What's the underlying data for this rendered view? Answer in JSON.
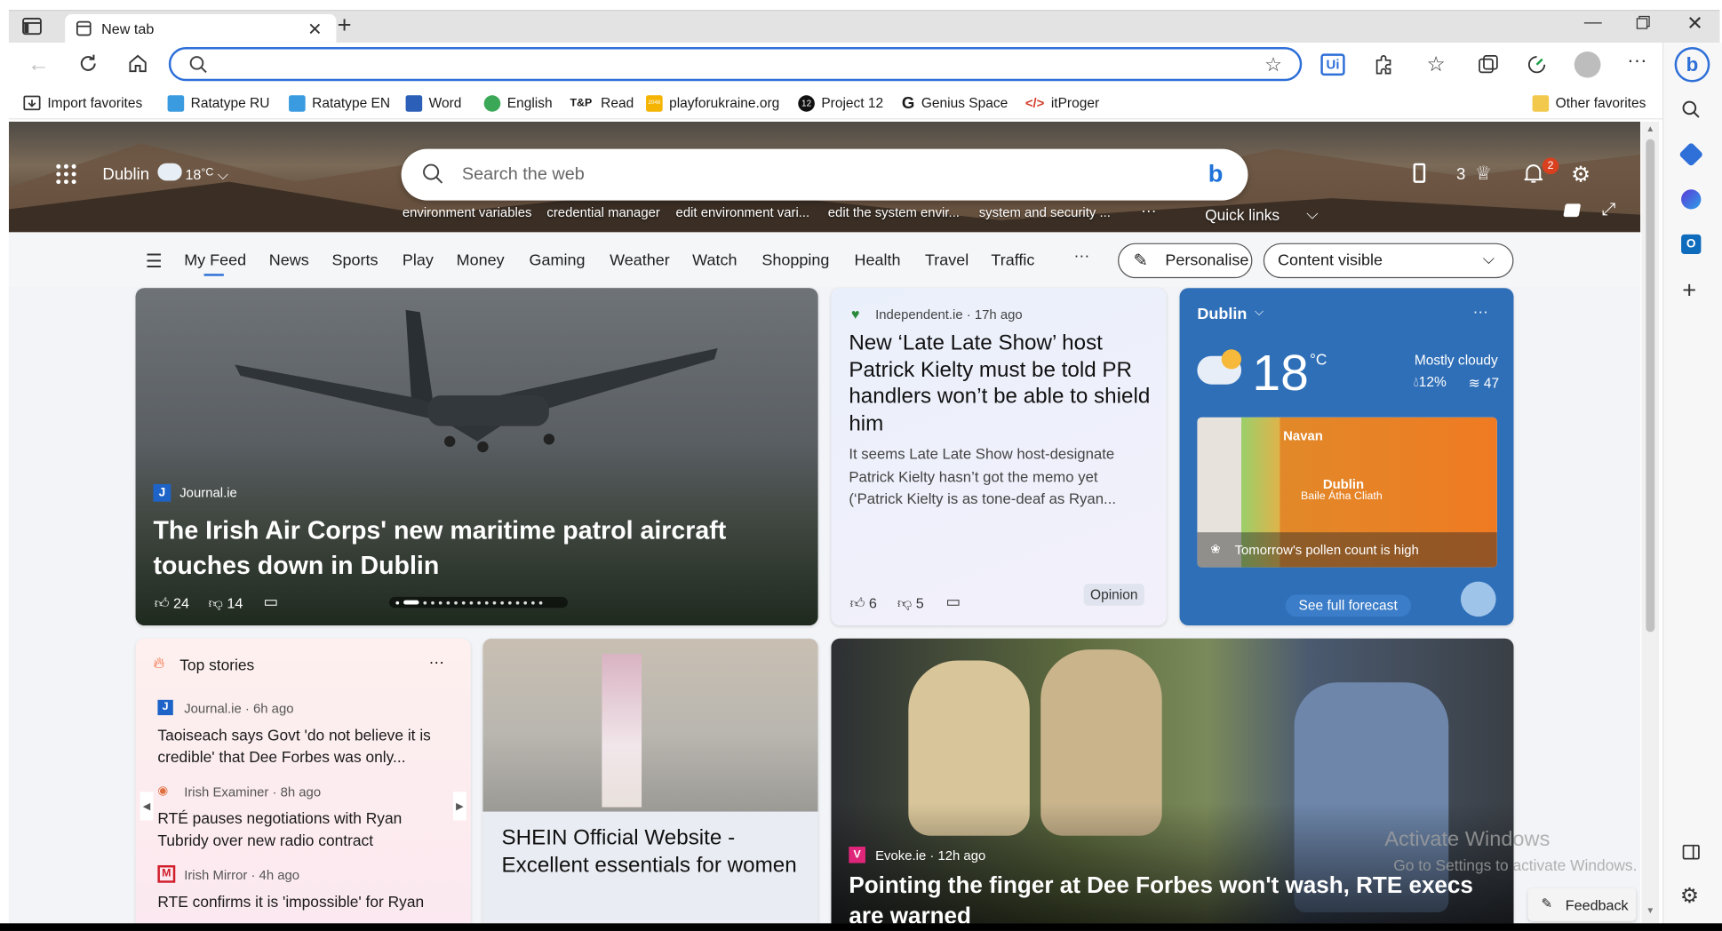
{
  "browser": {
    "tab_title": "New tab",
    "address_value": "",
    "favorites": [
      {
        "label": "Import favorites",
        "icon": "import-icon"
      },
      {
        "label": "Ratatype  RU",
        "icon": "ratatype-icon"
      },
      {
        "label": "Ratatype EN",
        "icon": "ratatype-icon"
      },
      {
        "label": "Word",
        "icon": "word-icon"
      },
      {
        "label": "English",
        "icon": "check-icon"
      },
      {
        "label": "Read",
        "icon": "tp-icon"
      },
      {
        "label": "playforukraine.org",
        "icon": "game-2048-icon"
      },
      {
        "label": "Project 12",
        "icon": "project-12-icon"
      },
      {
        "label": "Genius Space",
        "icon": "genius-icon"
      },
      {
        "label": "itProger",
        "icon": "code-icon"
      }
    ],
    "other_favorites": "Other favorites",
    "tp_icon_text": "T&P",
    "game_icon_text": "2048",
    "project_icon_text": "12"
  },
  "newtab": {
    "location": "Dublin",
    "temp": "18",
    "temp_unit": "°C",
    "search_placeholder": "Search the web",
    "search_chips": [
      "environment variables",
      "credential manager",
      "edit environment vari...",
      "edit the system envir...",
      "system and security ..."
    ],
    "more_chips": "···",
    "quick_links": "Quick links",
    "rewards_count": "3",
    "notification_count": "2"
  },
  "nav": {
    "items": [
      "My Feed",
      "News",
      "Sports",
      "Play",
      "Money",
      "Gaming",
      "Weather",
      "Watch",
      "Shopping",
      "Health",
      "Travel",
      "Traffic"
    ],
    "more": "···",
    "personalise": "Personalise",
    "content_visible": "Content visible"
  },
  "hero_card": {
    "source_logo": "J",
    "source": "Journal.ie",
    "title": "The Irish Air Corps' new maritime patrol aircraft touches down in Dublin",
    "likes": "24",
    "dislikes": "14"
  },
  "article_card": {
    "source": "Independent.ie · 17h ago",
    "title": "New ‘Late Late Show’ host Patrick Kielty must be told PR handlers won’t be able to shield him",
    "snippet": "It seems Late Late Show host-designate Patrick Kielty hasn’t got the memo yet (‘Patrick Kielty is as tone-deaf as Ryan...",
    "likes": "6",
    "dislikes": "5",
    "tag": "Opinion"
  },
  "weather_card": {
    "location": "Dublin",
    "temp": "18",
    "unit": "°C",
    "condition": "Mostly cloudy",
    "precip": "12%",
    "aqi": "47",
    "map_labels": [
      "Navan",
      "Dublin",
      "Baile Átha Cliath"
    ],
    "pollen": "Tomorrow's pollen count is high",
    "forecast_button": "See full forecast",
    "more": "···"
  },
  "top_stories": {
    "header": "Top stories",
    "more": "···",
    "items": [
      {
        "source": "Journal.ie · 6h ago",
        "title": "Taoiseach says Govt 'do not believe it is credible' that Dee Forbes was only..."
      },
      {
        "source": "Irish Examiner · 8h ago",
        "title": "RTÉ pauses negotiations with Ryan Tubridy over new radio contract"
      },
      {
        "source": "Irish Mirror · 4h ago",
        "title": "RTE confirms it is 'impossible' for Ryan"
      }
    ]
  },
  "ad_card": {
    "title": "SHEIN Official Website - Excellent essentials for women"
  },
  "bottom_card": {
    "source": "Evoke.ie · 12h ago",
    "title": "Pointing the finger at Dee Forbes won't wash, RTE execs are warned"
  },
  "watermark": {
    "line1": "Activate Windows",
    "line2": "Go to Settings to activate Windows."
  },
  "feedback": "Feedback",
  "colors": {
    "accent": "#2e6fd8",
    "weather_bg": "#2f6fb8",
    "notification_badge": "#d9401f"
  }
}
